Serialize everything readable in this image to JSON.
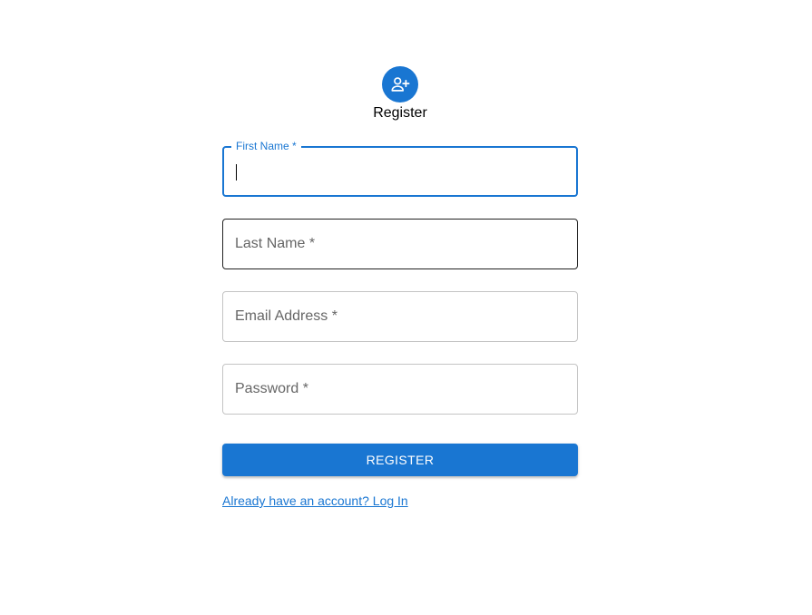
{
  "header": {
    "icon": "person-add-icon",
    "title": "Register"
  },
  "form": {
    "first_name": {
      "label": "First Name *",
      "value": ""
    },
    "last_name": {
      "label": "Last Name *",
      "value": ""
    },
    "email": {
      "label": "Email Address *",
      "value": ""
    },
    "password": {
      "label": "Password *",
      "value": ""
    },
    "submit_label": "REGISTER",
    "login_link": "Already have an account? Log In"
  },
  "colors": {
    "primary": "#1976d2",
    "border": "#c4c4c4",
    "text": "#000000"
  }
}
